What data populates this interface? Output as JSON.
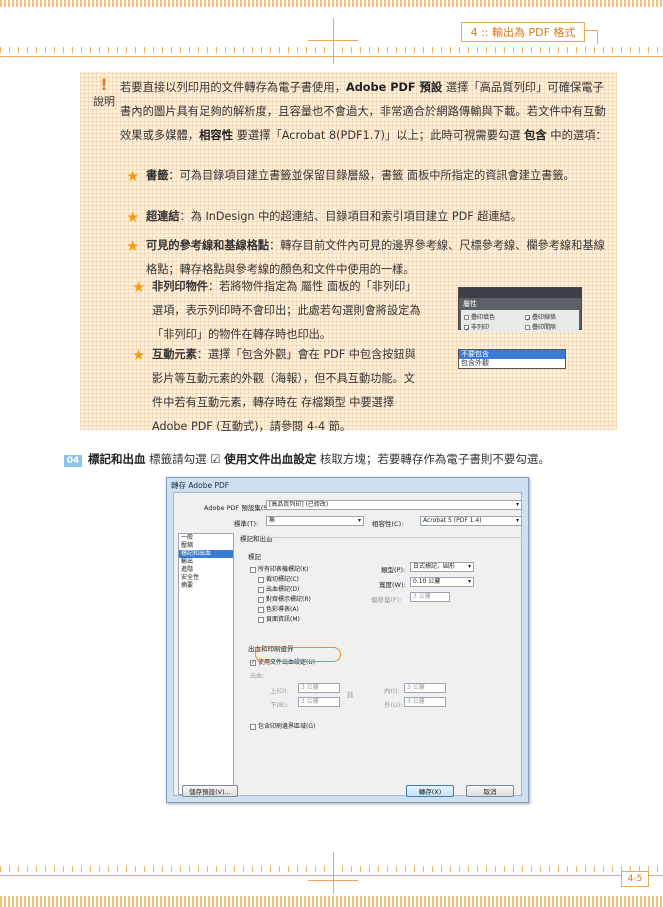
{
  "header": {
    "chapter_tab": "4 :: 輸出為 PDF 格式"
  },
  "note": {
    "icon_label": "說明",
    "intro": [
      {
        "t": "若要直接以列印用的文件轉存為電子書使用，"
      },
      {
        "t": "Adobe PDF 預設",
        "b": true
      },
      {
        "t": " 選擇「高品質列印」可確保電子書內的圖片具有足夠的解析度，且容量也不會過大，非常適合於網路傳輸與下載。若文件中有互動效果或多媒體，"
      },
      {
        "t": "相容性",
        "b": true
      },
      {
        "t": " 要選擇「Acrobat 8(PDF1.7)」以上；此時可視需要勾選 "
      },
      {
        "t": "包含",
        "b": true
      },
      {
        "t": " 中的選項："
      }
    ],
    "items": [
      {
        "title": "書籤",
        "text": "：可為目錄項目建立書籤並保留目錄層級，書籤 面板中所指定的資訊會建立書籤。"
      },
      {
        "title": "超連結",
        "text": "：為 InDesign 中的超連結、目錄項目和索引項目建立 PDF 超連結。"
      },
      {
        "title": "可見的參考線和基線格點",
        "text": "：轉存目前文件內可見的邊界參考線、尺標參考線、欄參考線和基線格點；轉存格點與參考線的顏色和文件中使用的一樣。"
      },
      {
        "title": "非列印物件",
        "text": "：若將物件指定為 屬性 面板的「非列印」選項，表示列印時不會印出；此處若勾選則會將設定為「非列印」的物件在轉存時也印出。"
      },
      {
        "title": "互動元素",
        "text": "：選擇「包含外觀」會在 PDF 中包含按鈕與影片等互動元素的外觀（海報），但不具互動功能。文件中若有互動元素，轉存時在 存檔類型 中要選擇 Adobe PDF (互動式)，請參閱 4-4 節。"
      }
    ],
    "attr_panel": {
      "tab": "屬性",
      "options": [
        "疊印填色",
        "疊印線條",
        "非列印",
        "疊印間隙"
      ],
      "checked": [
        "",
        "✓",
        "✓",
        ""
      ]
    },
    "appearance_dropdown": [
      "不要包含",
      "包含外觀"
    ]
  },
  "step": {
    "number": "04",
    "parts": [
      {
        "t": "標記和出血",
        "b": true
      },
      {
        "t": " 標籤請勾選 ☑ "
      },
      {
        "t": "使用文件出血設定",
        "b": true
      },
      {
        "t": " 核取方塊；若要轉存作為電子書則不要勾選。"
      }
    ]
  },
  "dialog": {
    "title": "轉存 Adobe PDF",
    "preset_label": "Adobe PDF 預設集(S):",
    "preset_value": "[高品質列印] (已修改)",
    "standard_label": "標準(T):",
    "standard_value": "無",
    "compat_label": "相容性(C):",
    "compat_value": "Acrobat 5 (PDF 1.4)",
    "side_items": [
      "一般",
      "壓縮",
      "標記和出血",
      "輸出",
      "進階",
      "安全性",
      "摘要"
    ],
    "side_selected": 2,
    "section_title": "標記和出血",
    "marks_title": "標記",
    "marks": [
      "所有印表機標記(K)",
      "裁切標記(C)",
      "出血標記(D)",
      "對齊標示標記(R)",
      "色彩導表(A)",
      "頁面資訊(M)"
    ],
    "type_label": "類型(P):",
    "type_value": "日式標記，圓形",
    "weight_label": "寬度(W):",
    "weight_value": "0.10 公釐",
    "offset_label": "偏移量(F):",
    "offset_value": "3 公釐",
    "bleed_section": "出血和印刷邊界",
    "use_bleed": "使用文件出血設定(U)",
    "bleed_label": "出血:",
    "top_label": "上(O):",
    "top_value": "3 公釐",
    "bottom_label": "下(B):",
    "bottom_value": "3 公釐",
    "inside_label": "內(I):",
    "inside_value": "3 公釐",
    "outside_label": "外(U):",
    "outside_value": "3 公釐",
    "slug_label": "包含印刷邊界區域(G)",
    "save_preset": "儲存預設(V)...",
    "export": "轉存(X)",
    "cancel": "取消"
  },
  "footer": {
    "page_number": "4-5"
  }
}
